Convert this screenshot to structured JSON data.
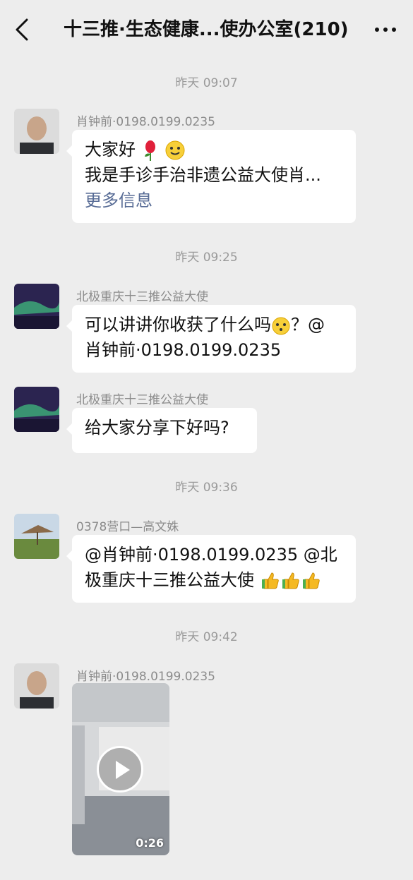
{
  "header": {
    "title": "十三推·生态健康...使办公室(210)",
    "back_icon": "chevron-left-icon",
    "more_icon": "more-dots-icon"
  },
  "times": [
    "昨天 09:07",
    "昨天 09:25",
    "昨天 09:36",
    "昨天 09:42"
  ],
  "messages": [
    {
      "sender": "肖钟前·0198.0199.0235",
      "line1": "大家好",
      "line2": "我是手诊手治非遗公益大使肖...",
      "link": "更多信息"
    },
    {
      "sender": "北极重庆十三推公益大使",
      "line1": "可以讲讲你收获了什么吗",
      "line1b": "？@",
      "line2": "肖钟前·0198.0199.0235"
    },
    {
      "sender": "北极重庆十三推公益大使",
      "line1": "给大家分享下好吗?"
    },
    {
      "sender": "0378营口—高文姝",
      "line1": "@肖钟前·0198.0199.0235 @北",
      "line2": "极重庆十三推公益大使"
    },
    {
      "sender": "肖钟前·0198.0199.0235",
      "duration": "0:26"
    }
  ]
}
